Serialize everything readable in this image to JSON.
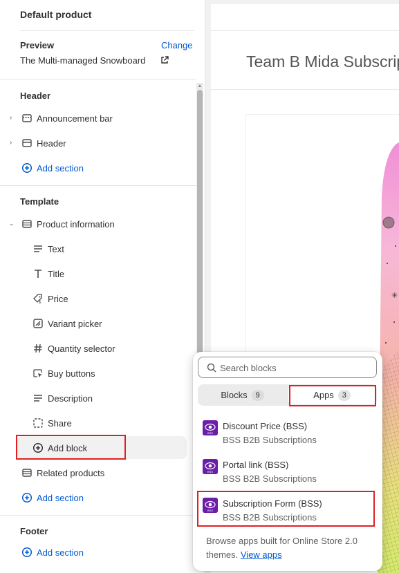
{
  "sidebar": {
    "title": "Default product",
    "preview_label": "Preview",
    "change_label": "Change",
    "preview_value": "The Multi-managed Snowboard",
    "header_section": {
      "title": "Header",
      "items": [
        {
          "label": "Announcement bar",
          "icon": "section-icon"
        },
        {
          "label": "Header",
          "icon": "section-icon"
        }
      ],
      "add_section": "Add section"
    },
    "template_section": {
      "title": "Template",
      "product_information": "Product information",
      "blocks": [
        {
          "label": "Text",
          "icon": "text-lines-icon"
        },
        {
          "label": "Title",
          "icon": "title-t-icon"
        },
        {
          "label": "Price",
          "icon": "price-tag-icon"
        },
        {
          "label": "Variant picker",
          "icon": "variant-icon"
        },
        {
          "label": "Quantity selector",
          "icon": "hash-icon"
        },
        {
          "label": "Buy buttons",
          "icon": "cursor-click-icon"
        },
        {
          "label": "Description",
          "icon": "text-lines-icon"
        },
        {
          "label": "Share",
          "icon": "share-dashed-icon"
        }
      ],
      "add_block": "Add block",
      "related_products": "Related products",
      "add_section": "Add section"
    },
    "footer_section": {
      "title": "Footer",
      "add_section": "Add section"
    }
  },
  "preview": {
    "product_title": "Team B Mida Subscrip"
  },
  "popover": {
    "search_placeholder": "Search blocks",
    "tabs": [
      {
        "label": "Blocks",
        "count": "9"
      },
      {
        "label": "Apps",
        "count": "3"
      }
    ],
    "apps": [
      {
        "name": "Discount Price (BSS)",
        "provider": "BSS B2B Subscriptions"
      },
      {
        "name": "Portal link (BSS)",
        "provider": "BSS B2B Subscriptions"
      },
      {
        "name": "Subscription Form (BSS)",
        "provider": "BSS B2B Subscriptions"
      }
    ],
    "footer_text": "Browse apps built for Online Store 2.0 themes.",
    "footer_link": "View apps"
  },
  "colors": {
    "accent": "#005bd3",
    "highlight": "#e02020",
    "app_logo": "#6b1fa8"
  }
}
